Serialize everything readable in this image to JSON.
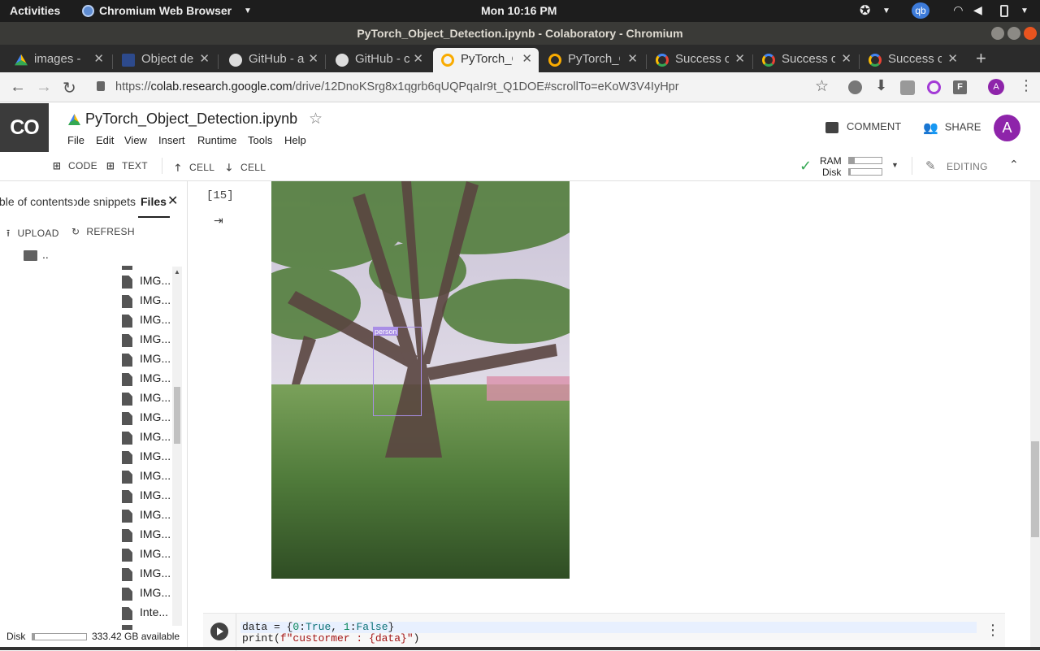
{
  "system_bar": {
    "activities": "Activities",
    "app_name": "Chromium Web Browser",
    "clock": "Mon 10:16 PM",
    "user_badge": "qb"
  },
  "window": {
    "title": "PyTorch_Object_Detection.ipynb - Colaboratory - Chromium"
  },
  "tabs": [
    {
      "title": "images - G",
      "icon": "drive-icon"
    },
    {
      "title": "Object de",
      "icon": "doc-icon"
    },
    {
      "title": "GitHub - a",
      "icon": "github-icon"
    },
    {
      "title": "GitHub - c",
      "icon": "github-icon"
    },
    {
      "title": "PyTorch_C",
      "icon": "colab-icon",
      "active": true
    },
    {
      "title": "PyTorch_C",
      "icon": "colab-icon"
    },
    {
      "title": "Success c",
      "icon": "google-icon"
    },
    {
      "title": "Success c",
      "icon": "google-icon"
    },
    {
      "title": "Success c",
      "icon": "google-icon"
    }
  ],
  "address_bar": {
    "scheme": "https://",
    "domain": "colab.research.google.com",
    "path": "/drive/12DnoKSrg8x1qgrb6qUQPqaIr9t_Q1DOE#scrollTo=eKoW3V4IyHpr",
    "profile_initial": "A"
  },
  "colab": {
    "logo": "CO",
    "notebook_title": "PyTorch_Object_Detection.ipynb",
    "menu": [
      "File",
      "Edit",
      "View",
      "Insert",
      "Runtime",
      "Tools",
      "Help"
    ],
    "comment_label": "COMMENT",
    "share_label": "SHARE",
    "avatar_initial": "A",
    "toolbar": {
      "code": "CODE",
      "text": "TEXT",
      "cell_up": "CELL",
      "cell_down": "CELL",
      "ram": "RAM",
      "disk": "Disk",
      "ram_usage": 0.18,
      "disk_usage": 0.05,
      "editing": "EDITING"
    }
  },
  "side_panel": {
    "tabs": [
      "Table of contents",
      "Code snippets",
      "Files"
    ],
    "upload": "UPLOAD",
    "refresh": "REFRESH",
    "parent_dir": "..",
    "files": [
      "IMG...",
      "IMG...",
      "IMG...",
      "IMG...",
      "IMG...",
      "IMG...",
      "IMG...",
      "IMG...",
      "IMG...",
      "IMG...",
      "IMG...",
      "IMG...",
      "IMG...",
      "IMG...",
      "IMG...",
      "IMG...",
      "IMG...",
      "Inte..."
    ],
    "disk_label": "Disk",
    "disk_available": "333.42 GB available",
    "disk_usage": 0.04
  },
  "output_cell": {
    "exec_count": "[15]",
    "detection_label": "person"
  },
  "code_cell": {
    "line1_a": "data = {",
    "line1_n0": "0",
    "line1_b": ":",
    "line1_t": "True",
    "line1_c": ", ",
    "line1_n1": "1",
    "line1_d": ":",
    "line1_f": "False",
    "line1_e": "}",
    "line2_a": "print(",
    "line2_s": "f\"custormer : {data}\"",
    "line2_b": ")"
  }
}
